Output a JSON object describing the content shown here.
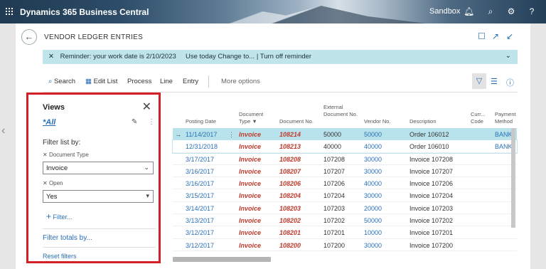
{
  "app": {
    "title": "Dynamics 365 Business Central",
    "environment": "Sandbox"
  },
  "page": {
    "title": "VENDOR LEDGER ENTRIES"
  },
  "reminder": {
    "text": "Reminder: your work date is 2/10/2023",
    "use_today": "Use today",
    "change_to": "Change to...",
    "separator": "|",
    "turn_off": "Turn off reminder"
  },
  "actions": {
    "search": "Search",
    "edit_list": "Edit List",
    "process": "Process",
    "line": "Line",
    "entry": "Entry",
    "more": "More options"
  },
  "views": {
    "heading": "Views",
    "all": "*All",
    "filter_list_by": "Filter list by:",
    "filters": [
      {
        "label": "Document Type",
        "value": "Invoice"
      },
      {
        "label": "Open",
        "value": "Yes"
      }
    ],
    "add_filter": "Filter...",
    "filter_totals_by": "Filter totals by...",
    "reset_filters": "Reset filters"
  },
  "table": {
    "columns": {
      "posting_date": "Posting Date",
      "document_type": "Document Type",
      "document_no": "Document No.",
      "external_document_no": "External Document No.",
      "vendor_no": "Vendor No.",
      "description": "Description",
      "currency_code": "Curr... Code",
      "payment_method": "Payment Method C..."
    },
    "rows": [
      {
        "date": "11/14/2017",
        "type": "Invoice",
        "doc": "108214",
        "ext": "50000",
        "vendor": "50000",
        "desc": "Order 106012",
        "pm": "BANK"
      },
      {
        "date": "12/31/2018",
        "type": "Invoice",
        "doc": "108213",
        "ext": "40000",
        "vendor": "40000",
        "desc": "Order 106010",
        "pm": "BANK"
      },
      {
        "date": "3/17/2017",
        "type": "Invoice",
        "doc": "108208",
        "ext": "107208",
        "vendor": "30000",
        "desc": "Invoice 107208",
        "pm": ""
      },
      {
        "date": "3/16/2017",
        "type": "Invoice",
        "doc": "108207",
        "ext": "107207",
        "vendor": "30000",
        "desc": "Invoice 107207",
        "pm": ""
      },
      {
        "date": "3/16/2017",
        "type": "Invoice",
        "doc": "108206",
        "ext": "107206",
        "vendor": "40000",
        "desc": "Invoice 107206",
        "pm": ""
      },
      {
        "date": "3/15/2017",
        "type": "Invoice",
        "doc": "108204",
        "ext": "107204",
        "vendor": "30000",
        "desc": "Invoice 107204",
        "pm": ""
      },
      {
        "date": "3/14/2017",
        "type": "Invoice",
        "doc": "108203",
        "ext": "107203",
        "vendor": "20000",
        "desc": "Invoice 107203",
        "pm": ""
      },
      {
        "date": "3/13/2017",
        "type": "Invoice",
        "doc": "108202",
        "ext": "107202",
        "vendor": "50000",
        "desc": "Invoice 107202",
        "pm": ""
      },
      {
        "date": "3/12/2017",
        "type": "Invoice",
        "doc": "108201",
        "ext": "107201",
        "vendor": "10000",
        "desc": "Invoice 107201",
        "pm": ""
      },
      {
        "date": "3/12/2017",
        "type": "Invoice",
        "doc": "108200",
        "ext": "107200",
        "vendor": "30000",
        "desc": "Invoice 107200",
        "pm": ""
      }
    ]
  },
  "colors": {
    "accent": "#2a6fb5",
    "highlight_border": "#d32027",
    "reminder_bg": "#bfe4ea",
    "selected_row": "#b9e3ec",
    "doc_text": "#c0392b"
  }
}
